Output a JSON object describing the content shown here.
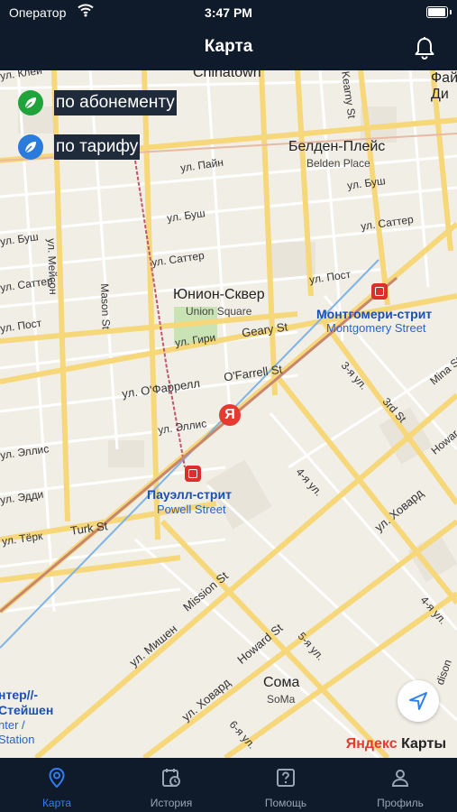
{
  "status_bar": {
    "carrier": "Оператор",
    "time": "3:47 PM"
  },
  "header": {
    "title": "Карта"
  },
  "legend": [
    {
      "label": "по абонементу",
      "color": "#1fa33a"
    },
    {
      "label": "по тарифу",
      "color": "#2b7bdc"
    }
  ],
  "map": {
    "districts": {
      "chinatown": "Chinatown",
      "belden_ru": "Белден-Плейс",
      "belden_en": "Belden Place",
      "union_ru": "Юнион-Сквер",
      "union_en": "Union Square",
      "soma_ru": "Сома",
      "soma_en": "SoMa",
      "corner_top_right": "Фай\nДи"
    },
    "stations": {
      "montgomery_ru": "Монтгомери-стрит",
      "montgomery_en": "Montgomery Street",
      "powell_ru": "Пауэлл-стрит",
      "powell_en": "Powell Street",
      "transbay_ru": "нтер//-\nСтейшен",
      "transbay_en": "nter /\nStation"
    },
    "streets": {
      "pine": "ул. Пайн",
      "bush1": "ул. Буш",
      "bush2": "ул. Буш",
      "bush3": "ул. Буш",
      "sutter1": "ул. Саттер",
      "sutter2": "ул. Саттер",
      "sutter3": "ул. Саттер",
      "post1": "ул. Пост",
      "post2": "ул. Пост",
      "geary_ru": "ул. Гири",
      "geary_en": "Geary St",
      "ofarrell_ru": "ул. О'Фаррелл",
      "ofarrell_en": "O'Farrell St",
      "ellis1": "ул. Эллис",
      "ellis2": "ул. Эллис",
      "eddy": "ул. Эдди",
      "turk_ru": "ул. Тёрк",
      "turk_en": "Turk St",
      "mason_ru": "ул. Мейсон",
      "mason_en": "Mason St",
      "mission_ru": "ул. Мишен",
      "mission_en": "Mission St",
      "howard_ru1": "ул. Ховард",
      "howard_en": "Howard St",
      "howard_ru2": "ул. Ховард",
      "third_ru": "3-я ул.",
      "third_en": "3rd St",
      "fourth": "4-я ул.",
      "fourth2": "4-я ул.",
      "fifth": "5-я ул.",
      "sixth": "6-я ул.",
      "mina": "Mina St",
      "howard_right": "Howar",
      "kleyn": "ул. Клей",
      "left_bush": "ул. Буш",
      "left_sutter": "ул. Саттер",
      "left_post": "ул. Пост",
      "left_ellis": "ул. Эллис",
      "kearny": "Kearny St",
      "dison": "dison"
    },
    "attribution": {
      "ya": "Яндекс",
      "maps": " Карты"
    }
  },
  "tabs": [
    {
      "label": "Карта",
      "icon": "map-pin-icon",
      "active": true
    },
    {
      "label": "История",
      "icon": "history-icon",
      "active": false
    },
    {
      "label": "Помощь",
      "icon": "help-icon",
      "active": false
    },
    {
      "label": "Профиль",
      "icon": "profile-icon",
      "active": false
    }
  ]
}
